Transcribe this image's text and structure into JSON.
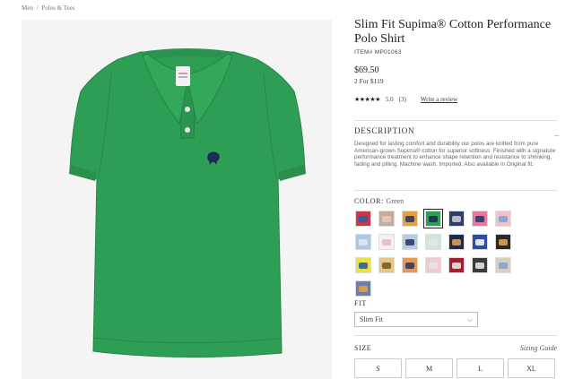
{
  "breadcrumb": {
    "items": [
      "Men",
      "/",
      "Polos & Tees"
    ]
  },
  "product": {
    "title": "Slim Fit Supima® Cotton Performance Polo Shirt",
    "item_number": "ITEM# MP01063",
    "price": "$69.50",
    "promo": "2 For $119",
    "rating_stars": "★★★★★",
    "rating_value": "5.0",
    "review_count": "(3)",
    "write_review": "Write a review",
    "image_color": "#2f9e55"
  },
  "description": {
    "title": "DESCRIPTION",
    "toggle": "–",
    "text": "Designed for lasting comfort and durability our polos are knitted from pure American-grown Supima® cotton for superior softness. Finished with a signature performance treatment to enhance shape retention and resistance to shrinking, fading and pilling. Machine wash. Imported. Also available in Original fit."
  },
  "color": {
    "label": "COLOR:",
    "selected": "Green",
    "swatches": [
      {
        "bg": "#c8374a",
        "fleece": "#2f5fa0"
      },
      {
        "bg": "#c9a9a0",
        "fleece": "#d9d0c0"
      },
      {
        "bg": "#e2a13f",
        "fleece": "#2f3b6b"
      },
      {
        "bg": "#2f9e55",
        "fleece": "#1c2d55",
        "selected": true
      },
      {
        "bg": "#2c3d6e",
        "fleece": "#c9c9c9"
      },
      {
        "bg": "#e07aa0",
        "fleece": "#2f3b6b"
      },
      {
        "bg": "#f2c2cc",
        "fleece": "#7aa6d9"
      },
      {
        "bg": "#a9c8ea",
        "fleece": "#e6e6e6"
      },
      {
        "bg": "#f4f2ee",
        "fleece": "#f0b8c3"
      },
      {
        "bg": "#b9cbe0",
        "fleece": "#2f3b6b"
      },
      {
        "bg": "#cfe5dc",
        "fleece": "#e6e6e6"
      },
      {
        "bg": "#1f2b4d",
        "fleece": "#e2a13f"
      },
      {
        "bg": "#2f4f9e",
        "fleece": "#f4f4f4"
      },
      {
        "bg": "#2a2a2a",
        "fleece": "#e2a13f"
      },
      {
        "bg": "#e8e04a",
        "fleece": "#2f5fa0"
      },
      {
        "bg": "#e6c58a",
        "fleece": "#7a5a30"
      },
      {
        "bg": "#e29a5c",
        "fleece": "#2f3b6b"
      },
      {
        "bg": "#f2c9d1",
        "fleece": "#e6e6e6"
      },
      {
        "bg": "#a21f2f",
        "fleece": "#e6e6e6"
      },
      {
        "bg": "#3b3b3b",
        "fleece": "#e6e6e6"
      },
      {
        "bg": "#d9d0c0",
        "fleece": "#7aa6d9"
      },
      {
        "bg": "#6b7fa8",
        "fleece": "#e2a13f"
      }
    ]
  },
  "fit": {
    "label": "FIT",
    "selected": "Slim Fit"
  },
  "size": {
    "label": "SIZE",
    "guide": "Sizing Guide",
    "options": [
      "S",
      "M",
      "L",
      "XL"
    ]
  }
}
